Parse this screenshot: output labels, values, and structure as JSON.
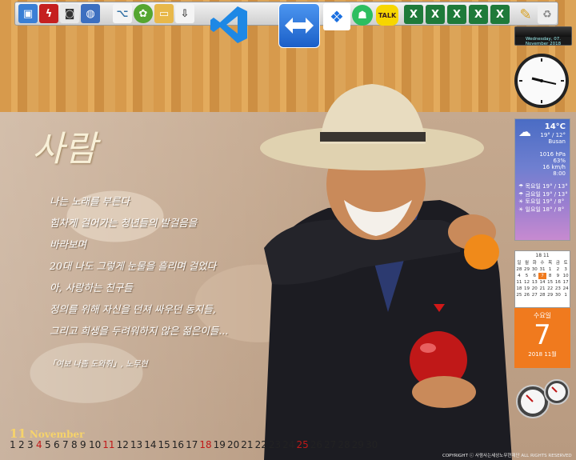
{
  "toolbar": {
    "icons": [
      {
        "name": "app-icon",
        "color": "#3a7fd5"
      },
      {
        "name": "flash-icon",
        "color": "#c52020"
      },
      {
        "name": "camera-icon",
        "color": "#333333"
      },
      {
        "name": "globe-icon",
        "color": "#3c6fc0"
      },
      {
        "name": "python-icon",
        "color": "#3572a5"
      },
      {
        "name": "android-icon",
        "color": "#55a630"
      },
      {
        "name": "folder-icon",
        "color": "#e8b84a"
      },
      {
        "name": "downloader-icon",
        "color": "#5a5a5a"
      },
      {
        "name": "vscode-icon",
        "color": "#1e88e5"
      },
      {
        "name": "teamviewer-icon",
        "color": "#1f6fd6"
      },
      {
        "name": "dropbox-icon",
        "color": "#1a6fe0"
      },
      {
        "name": "evernote-icon",
        "color": "#2dbe60"
      },
      {
        "name": "kakaotalk-icon",
        "color": "#f7d600"
      },
      {
        "name": "excel-icon",
        "color": "#1f7a3a"
      },
      {
        "name": "tools-icon",
        "color": "#d8a020"
      },
      {
        "name": "recycle-bin-icon",
        "color": "#aaaaaa"
      }
    ],
    "kakao_label": "TALK"
  },
  "wallpaper": {
    "title": "사람",
    "poem_lines": [
      "나는 노래를 부른다",
      "힘차게 걸어가는 청년들의 발걸음을",
      "바라보며",
      "20대 나도 그렇게 눈물을 흘리며 걸었다",
      "아, 사랑하는 친구들",
      "정의를 위해 자신을 던져 싸우던 동지들,",
      "그리고 희생을 두려워하지 않은 젊은이들...",
      ""
    ],
    "source": "「여보 나좀 도와줘」, 노무현"
  },
  "calendar_strip": {
    "month_number": "11",
    "month_name": "November",
    "days": [
      "1",
      "2",
      "3",
      "4",
      "5",
      "6",
      "7",
      "8",
      "9",
      "10",
      "11",
      "12",
      "13",
      "14",
      "15",
      "16",
      "17",
      "18",
      "19",
      "20",
      "21",
      "22",
      "23",
      "24",
      "25",
      "26",
      "27",
      "28",
      "29",
      "30"
    ],
    "red_days": [
      "4",
      "11",
      "18",
      "25"
    ]
  },
  "gadgets": {
    "clock_bar_text": "Wednesday, 07. November 2018",
    "weather": {
      "temp": "14°C",
      "range": "19° / 12°",
      "city": "Busan",
      "details": [
        "1016 hPa",
        "63%",
        "16 km/h",
        "8:00"
      ],
      "forecast": [
        {
          "day": "목요일",
          "range": "19° / 13°"
        },
        {
          "day": "금요일",
          "range": "19° / 13°"
        },
        {
          "day": "토요일",
          "range": "19° / 8°"
        },
        {
          "day": "일요일",
          "range": "18° / 8°"
        }
      ]
    },
    "mini_calendar": {
      "header": "18 11",
      "weekdays": [
        "일",
        "월",
        "화",
        "수",
        "목",
        "금",
        "토"
      ],
      "rows": [
        [
          "28",
          "29",
          "30",
          "31",
          "1",
          "2",
          "3"
        ],
        [
          "4",
          "5",
          "6",
          "7",
          "8",
          "9",
          "10"
        ],
        [
          "11",
          "12",
          "13",
          "14",
          "15",
          "16",
          "17"
        ],
        [
          "18",
          "19",
          "20",
          "21",
          "22",
          "23",
          "24"
        ],
        [
          "25",
          "26",
          "27",
          "28",
          "29",
          "30",
          "1"
        ]
      ]
    },
    "date_card": {
      "weekday": "수요일",
      "day": "7",
      "month_label": "2018 11월"
    },
    "meters": [
      "cpu-meter",
      "ram-meter"
    ]
  },
  "copyright": "COPYRIGHT ⓒ 사람사는세상노무현재단 ALL RIGHTS RESERVED"
}
